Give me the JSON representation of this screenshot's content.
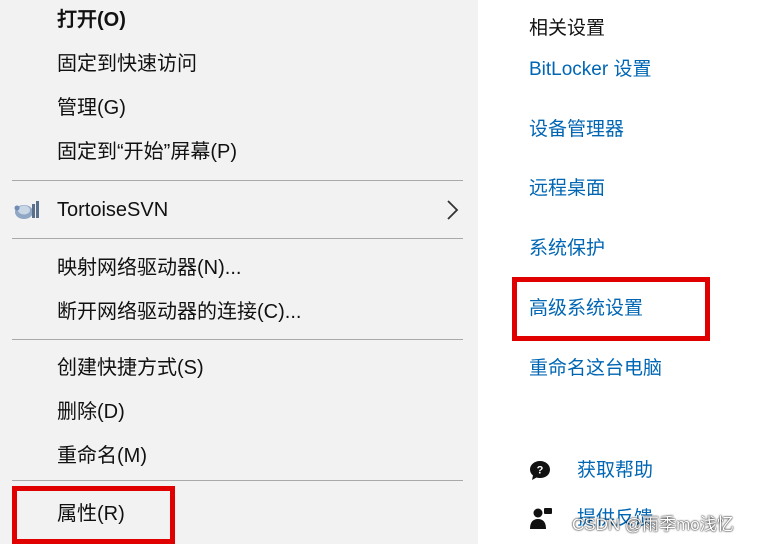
{
  "context_menu": {
    "items": [
      {
        "label": "打开(O)"
      },
      {
        "label": "固定到快速访问"
      },
      {
        "label": "管理(G)"
      },
      {
        "label": "固定到“开始”屏幕(P)"
      },
      {
        "label": "TortoiseSVN"
      },
      {
        "label": "映射网络驱动器(N)..."
      },
      {
        "label": "断开网络驱动器的连接(C)..."
      },
      {
        "label": "创建快捷方式(S)"
      },
      {
        "label": "删除(D)"
      },
      {
        "label": "重命名(M)"
      },
      {
        "label": "属性(R)"
      }
    ],
    "submenu_icon": "chevron-right-icon",
    "tortoise_icon": "tortoisesvn-icon"
  },
  "related_settings": {
    "title": "相关设置",
    "links": [
      {
        "label": "BitLocker 设置"
      },
      {
        "label": "设备管理器"
      },
      {
        "label": "远程桌面"
      },
      {
        "label": "系统保护"
      },
      {
        "label": "高级系统设置"
      },
      {
        "label": "重命名这台电脑"
      }
    ],
    "help": {
      "label": "获取帮助",
      "icon": "help-chat-icon"
    },
    "feedback": {
      "label": "提供反馈",
      "icon": "feedback-person-icon"
    }
  },
  "highlight_color": "#e00000",
  "link_color": "#0066b4",
  "watermark": "CSDN @雨季mo浅忆"
}
